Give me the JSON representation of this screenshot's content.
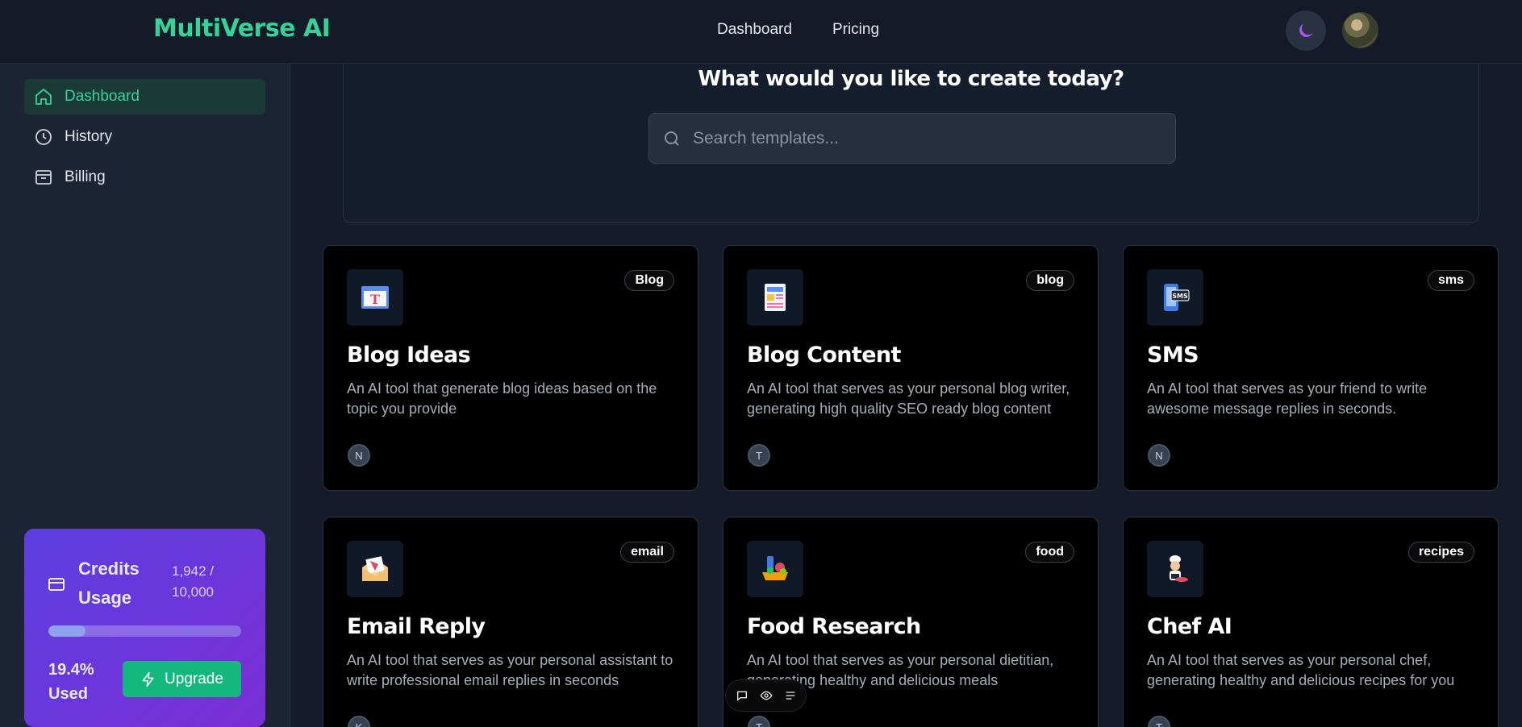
{
  "header": {
    "brand": "MultiVerse AI",
    "nav": [
      "Dashboard",
      "Pricing"
    ]
  },
  "sidebar": {
    "items": [
      {
        "label": "Dashboard",
        "icon": "home-icon",
        "active": true
      },
      {
        "label": "History",
        "icon": "clock-icon",
        "active": false
      },
      {
        "label": "Billing",
        "icon": "wallet-icon",
        "active": false
      }
    ]
  },
  "credits": {
    "title": "Credits Usage",
    "count": "1,942 / 10,000",
    "used_label": "19.4% Used",
    "used_fraction": 0.194,
    "upgrade_label": "Upgrade"
  },
  "hero": {
    "heading": "What would you like to create today?",
    "search_placeholder": "Search templates..."
  },
  "cards": [
    {
      "title": "Blog Ideas",
      "tag": "Blog",
      "desc": "An AI tool that generate blog ideas based on the topic you provide",
      "author": "N",
      "icon": "blog-ideas-icon"
    },
    {
      "title": "Blog Content",
      "tag": "blog",
      "desc": "An AI tool that serves as your personal blog writer, generating high quality SEO ready blog content",
      "author": "T",
      "icon": "blog-content-icon"
    },
    {
      "title": "SMS",
      "tag": "sms",
      "desc": "An AI tool that serves as your friend to write awesome message replies in seconds.",
      "author": "N",
      "icon": "sms-icon"
    },
    {
      "title": "Email Reply",
      "tag": "email",
      "desc": "An AI tool that serves as your personal assistant to write professional email replies in seconds",
      "author": "K",
      "icon": "email-icon"
    },
    {
      "title": "Food Research",
      "tag": "food",
      "desc": "An AI tool that serves as your personal dietitian, generating healthy and delicious meals",
      "author": "T",
      "icon": "food-icon"
    },
    {
      "title": "Chef AI",
      "tag": "recipes",
      "desc": "An AI tool that serves as your personal chef, generating healthy and delicious recipes for you",
      "author": "T",
      "icon": "chef-icon"
    }
  ]
}
